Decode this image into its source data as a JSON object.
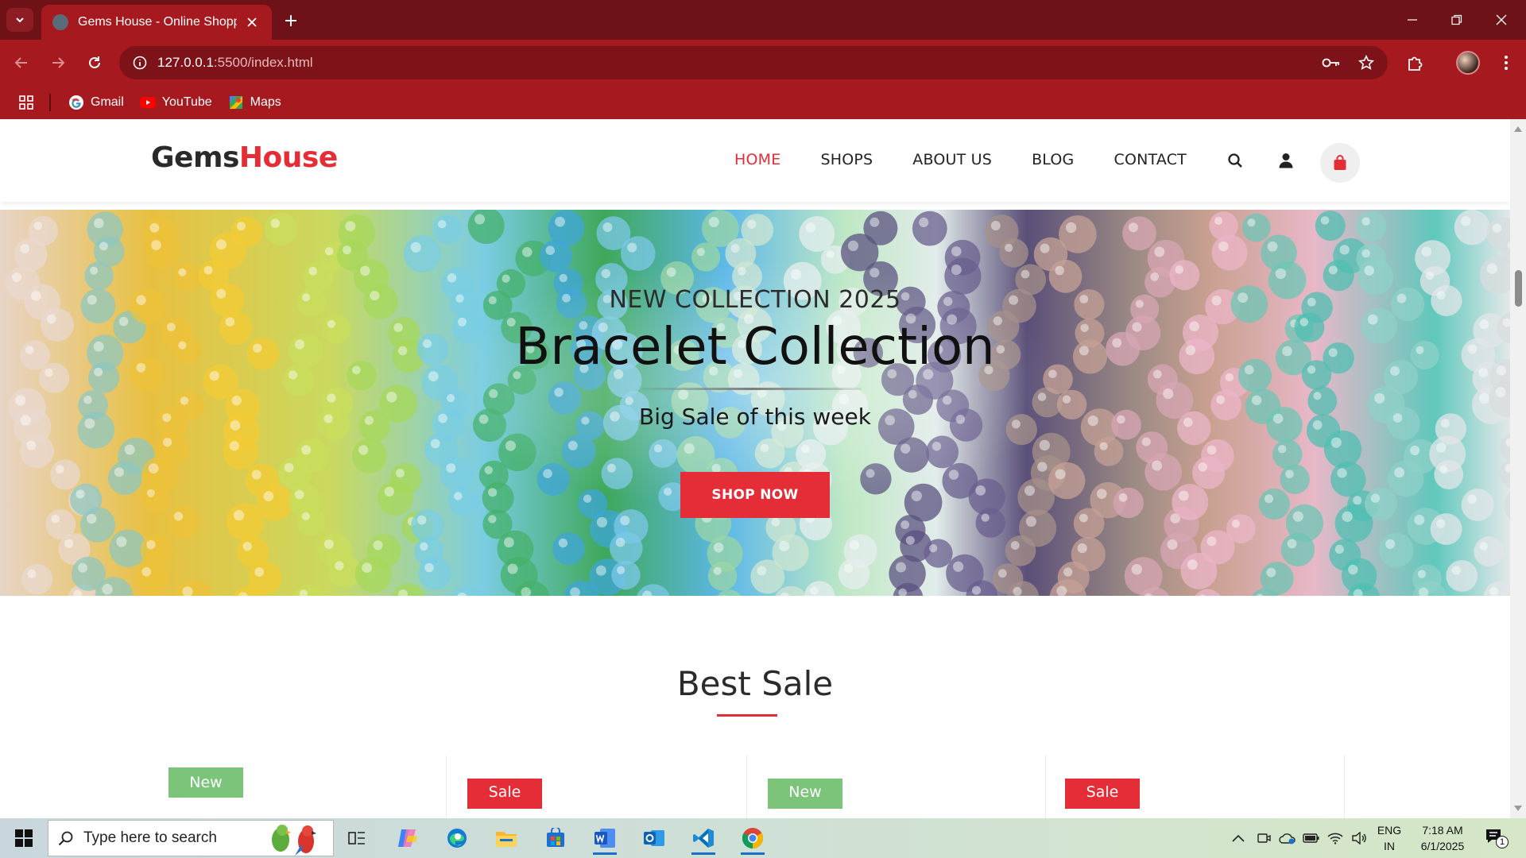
{
  "browser": {
    "tab": {
      "title": "Gems House - Online Shopping",
      "favicon": "globe-icon"
    },
    "address": {
      "host": "127.0.0.1",
      "rest": ":5500/index.html"
    },
    "bookmarks": [
      {
        "label": "Gmail",
        "icon": "gmail-icon"
      },
      {
        "label": "YouTube",
        "icon": "youtube-icon"
      },
      {
        "label": "Maps",
        "icon": "maps-icon"
      }
    ],
    "theme": {
      "frame": "#6e1218",
      "toolbar": "#a6191f",
      "omnibox": "#7d1218"
    }
  },
  "site": {
    "logo": {
      "part1": "Gems",
      "part2": "House"
    },
    "nav": [
      {
        "label": "HOME",
        "active": true
      },
      {
        "label": "SHOPS",
        "active": false
      },
      {
        "label": "ABOUT US",
        "active": false
      },
      {
        "label": "BLOG",
        "active": false
      },
      {
        "label": "CONTACT",
        "active": false
      }
    ],
    "accent": "#e52d38",
    "hero": {
      "kicker": "NEW COLLECTION 2025",
      "title": "Bracelet Collection",
      "subtitle": "Big Sale of this week",
      "cta": "SHOP NOW"
    },
    "best_sale": {
      "title": "Best Sale",
      "badges": [
        {
          "label": "New",
          "color": "#7cc47a"
        },
        {
          "label": "Sale",
          "color": "#e52d38"
        },
        {
          "label": "New",
          "color": "#7cc47a"
        },
        {
          "label": "Sale",
          "color": "#e52d38"
        }
      ]
    }
  },
  "taskbar": {
    "search_placeholder": "Type here to search",
    "language": {
      "line1": "ENG",
      "line2": "IN"
    },
    "clock": {
      "time": "7:18 AM",
      "date": "6/1/2025"
    },
    "notification_count": "1"
  }
}
